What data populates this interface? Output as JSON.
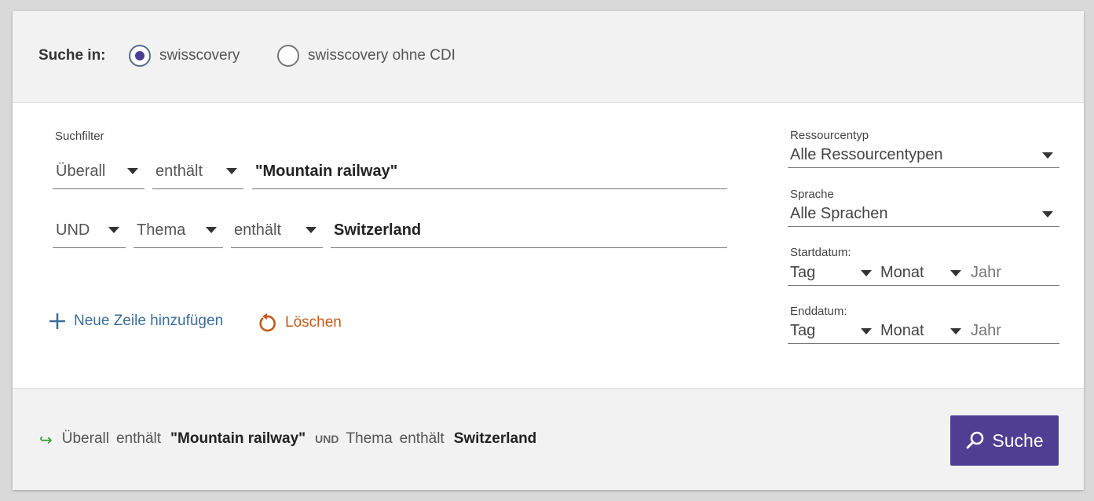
{
  "scope": {
    "label": "Suche in:",
    "options": [
      {
        "label": "swisscovery",
        "checked": true
      },
      {
        "label": "swisscovery ohne CDI",
        "checked": false
      }
    ]
  },
  "filters": {
    "label": "Suchfilter",
    "row1": {
      "field": "Überall",
      "condition": "enthält",
      "value": "\"Mountain railway\""
    },
    "row2": {
      "operator": "UND",
      "field": "Thema",
      "condition": "enthält",
      "value": "Switzerland"
    }
  },
  "actions": {
    "add_row": "Neue Zeile hinzufügen",
    "clear": "Löschen"
  },
  "facets": {
    "resource_type": {
      "label": "Ressourcentyp",
      "value": "Alle Ressourcentypen"
    },
    "language": {
      "label": "Sprache",
      "value": "Alle Sprachen"
    },
    "start_date": {
      "label": "Startdatum:",
      "day": "Tag",
      "month": "Monat",
      "year_placeholder": "Jahr"
    },
    "end_date": {
      "label": "Enddatum:",
      "day": "Tag",
      "month": "Monat",
      "year_placeholder": "Jahr"
    }
  },
  "summary": {
    "arrow": "↪",
    "field1": "Überall",
    "cond1": "enthält",
    "value1": "\"Mountain railway\"",
    "operator": "UND",
    "field2": "Thema",
    "cond2": "enthält",
    "value2": "Switzerland"
  },
  "search_button": {
    "label": "Suche"
  },
  "colors": {
    "primary": "#4e3f93",
    "link": "#3a6d99",
    "reset": "#c25a1c",
    "arrow": "#3a9a3a"
  }
}
